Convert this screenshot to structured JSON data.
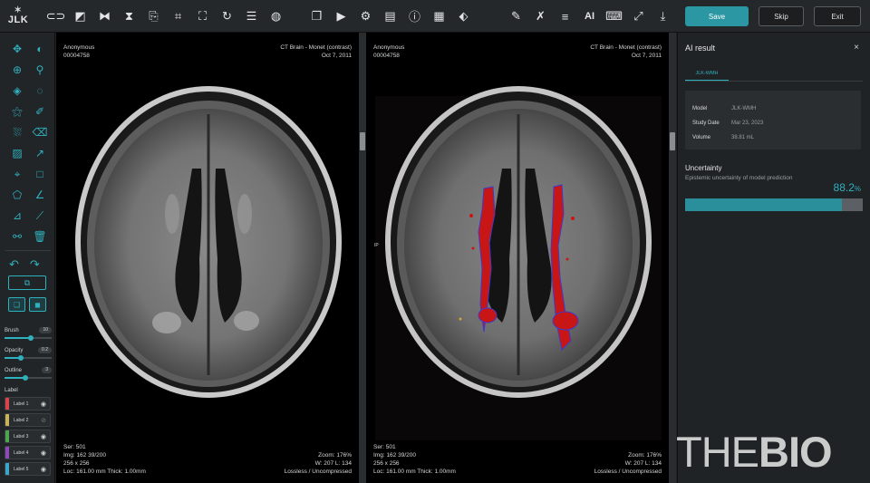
{
  "app": {
    "logo_text": "JLK",
    "logo_mark": "✶"
  },
  "toolbar": {
    "save_label": "Save",
    "skip_label": "Skip",
    "exit_label": "Exit",
    "ai_label": "AI"
  },
  "left_panel": {
    "sliders": [
      {
        "label": "Brush",
        "value": "10",
        "fill": 0.55
      },
      {
        "label": "Opacity",
        "value": "0.2",
        "fill": 0.35
      },
      {
        "label": "Outline",
        "value": "3",
        "fill": 0.45
      }
    ],
    "label_section_title": "Label",
    "labels": [
      {
        "name": "Label 1",
        "color": "#d9434a",
        "visible": true
      },
      {
        "name": "Label 2",
        "color": "#c9b35a",
        "visible": false
      },
      {
        "name": "Label 3",
        "color": "#4ba64f",
        "visible": true
      },
      {
        "name": "Label 4",
        "color": "#8c4bb8",
        "visible": true
      },
      {
        "name": "Label 5",
        "color": "#3aa7c9",
        "visible": true
      }
    ]
  },
  "viewports": [
    {
      "patient": "Anonymous",
      "patient_id": "00004758",
      "study": "CT Brain - Monet (contrast)",
      "date": "Oct 7, 2011",
      "series": "Ser: 501",
      "image": "Img: 162 39/200",
      "matrix": "256 x 256",
      "location": "Loc: 161.00 mm Thick: 1.00mm",
      "zoom": "Zoom: 176%",
      "window": "W: 207 L: 134",
      "compression": "Lossless / Uncompressed"
    },
    {
      "patient": "Anonymous",
      "patient_id": "00004758",
      "study": "CT Brain - Monet (contrast)",
      "date": "Oct 7, 2011",
      "series": "Ser: 501",
      "image": "Img: 162 39/200",
      "matrix": "256 x 256",
      "location": "Loc: 161.00 mm Thick: 1.00mm",
      "zoom": "Zoom: 176%",
      "window": "W: 207 L: 134",
      "compression": "Lossless / Uncompressed",
      "orientation_marker": "IP"
    }
  ],
  "ai_panel": {
    "title": "AI result",
    "close_glyph": "×",
    "tab": "JLK-WMH",
    "info": [
      {
        "key": "Model",
        "value": "JLK-WMH"
      },
      {
        "key": "Study Date",
        "value": "Mar 23, 2023"
      },
      {
        "key": "Volume",
        "value": "38.81 mL"
      }
    ],
    "uncertainty_title": "Uncertainty",
    "uncertainty_desc": "Epistemic uncertainty of model prediction",
    "uncertainty_value": "88.2",
    "uncertainty_unit": "%",
    "uncertainty_fraction": 0.882
  },
  "watermark": {
    "part1": "THE",
    "part2": "BIO"
  },
  "colors": {
    "accent": "#2fb0bd",
    "save": "#2b97a3",
    "lesion": "#c01818"
  }
}
